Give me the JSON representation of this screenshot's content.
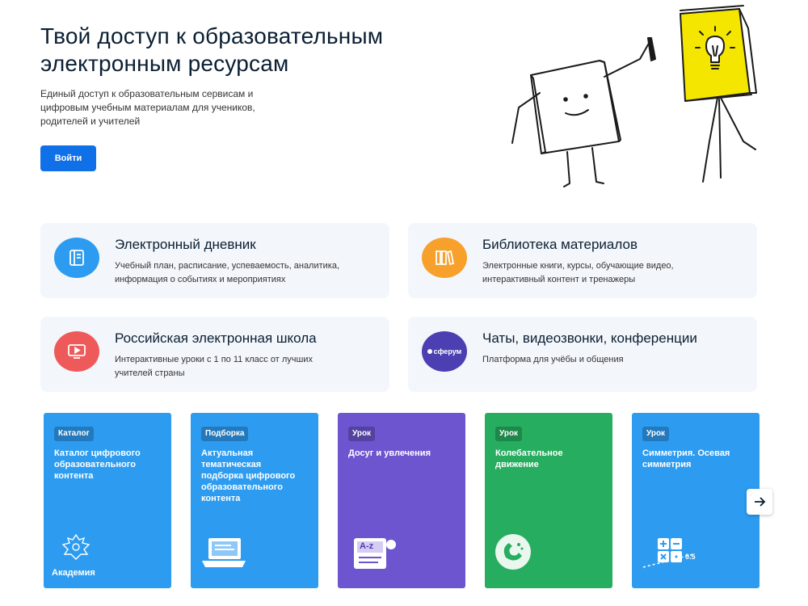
{
  "hero": {
    "title_line1": "Твой доступ к образовательным",
    "title_line2": "электронным ресурсам",
    "desc_line1": "Единый доступ к образовательным сервисам и",
    "desc_line2": "цифровым учебным материалам для учеников,",
    "desc_line3": "родителей и учителей",
    "login_label": "Войти"
  },
  "services": [
    {
      "title": "Электронный дневник",
      "desc_line1": "Учебный план, расписание, успеваемость, аналитика,",
      "desc_line2": "информация о событиях и мероприятиях",
      "icon": "diary-icon",
      "color": "#2d9cf0"
    },
    {
      "title": "Библиотека материалов",
      "desc_line1": "Электронные книги, курсы, обучающие видео,",
      "desc_line2": "интерактивный контент и тренажеры",
      "icon": "books-icon",
      "color": "#f7a12c"
    },
    {
      "title": "Российская электронная школа",
      "desc_line1": "Интерактивные уроки с 1 по 11 класс от лучших",
      "desc_line2": "учителей страны",
      "icon": "video-play-icon",
      "color": "#ee5a5a"
    },
    {
      "title": "Чаты, видеозвонки, конференции",
      "desc_line1": "Платформа для учёбы и общения",
      "desc_line2": "",
      "icon": "sferum-logo",
      "logo_text": "сферум",
      "color": "#4b3fb2"
    }
  ],
  "tiles": [
    {
      "badge": "Каталог",
      "title_lines": [
        "Каталог цифрового",
        "образовательного",
        "контента",
        "",
        ""
      ],
      "icon": "academy-emblem-icon",
      "logo_text": "Академия",
      "color": "#2d9cf0"
    },
    {
      "badge": "Подборка",
      "title_lines": [
        "Актуальная",
        "тематическая",
        "подборка цифрового",
        "образовательного",
        "контента"
      ],
      "icon": "laptop-icon",
      "color": "#2d9cf0"
    },
    {
      "badge": "Урок",
      "title_lines": [
        "Досуг и увлечения",
        "",
        "",
        "",
        ""
      ],
      "icon": "dictionary-icon",
      "glyph_text": "A-z",
      "color": "#6c55cf"
    },
    {
      "badge": "Урок",
      "title_lines": [
        "Колебательное",
        "движение",
        "",
        "",
        ""
      ],
      "icon": "magnet-icon",
      "color": "#27ad5f"
    },
    {
      "badge": "Урок",
      "title_lines": [
        "Симметрия. Осевая",
        "симметрия",
        "",
        "",
        ""
      ],
      "icon": "math-symbols-icon",
      "glyph_text": "0.5",
      "color": "#2d9cf0"
    }
  ],
  "carousel": {
    "next_icon": "arrow-right-icon"
  }
}
